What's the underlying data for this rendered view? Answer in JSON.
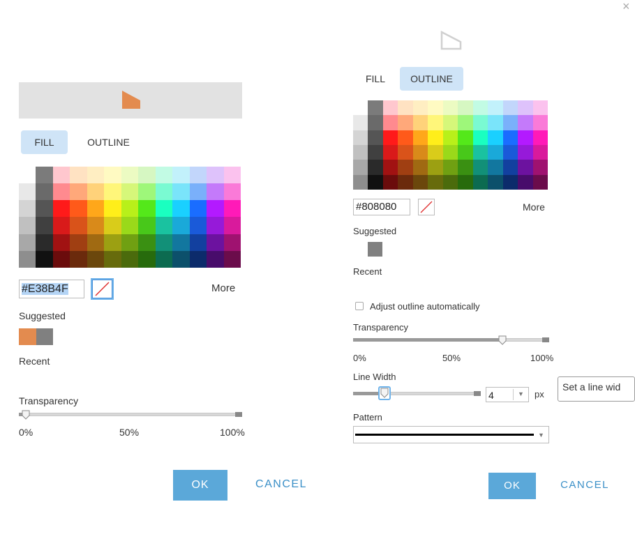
{
  "close_glyph": "×",
  "colors": {
    "accent": "#5ba8d9",
    "tab_active": "#cfe4f7",
    "fill_selected": "#E38B4F",
    "outline_selected": "#808080"
  },
  "palette": {
    "grays": [
      "#ffffff",
      "#e8e8e8",
      "#d4d4d4",
      "#c0c0c0",
      "#a8a8a8",
      "#8e8e8e"
    ],
    "darks": [
      "#7b7b7b",
      "#6a6a6a",
      "#555555",
      "#404040",
      "#2a2a2a",
      "#111111"
    ],
    "hues": [
      [
        "#ffc7ce",
        "#ffe2c2",
        "#ffeec2",
        "#fffac2",
        "#ecfbc2",
        "#d6f7c2",
        "#c2fbe4",
        "#c2f1fb",
        "#c2d6fb",
        "#dec2fb",
        "#fbc2ee"
      ],
      [
        "#ff8a8f",
        "#ffa87a",
        "#ffd27a",
        "#fff67a",
        "#d6f77a",
        "#9ef77a",
        "#7afad2",
        "#7ae4fa",
        "#7ab0fa",
        "#c47afa",
        "#fa7ad8"
      ],
      [
        "#ff1a1a",
        "#ff5a1a",
        "#ffa71a",
        "#ffee1a",
        "#b8f01a",
        "#54e81a",
        "#1affc0",
        "#1ad0ff",
        "#1a6dff",
        "#b31aff",
        "#ff1ab8"
      ],
      [
        "#d91a1a",
        "#d9531a",
        "#d98a1a",
        "#d9cc1a",
        "#9ad91a",
        "#48c81a",
        "#1ac2a0",
        "#1aa9d9",
        "#1a5ad9",
        "#961ad9",
        "#d91a9c"
      ],
      [
        "#a11212",
        "#a03f12",
        "#a06a12",
        "#9ca012",
        "#70a012",
        "#3a9012",
        "#129078",
        "#12779f",
        "#12409f",
        "#6c129f",
        "#9f1270"
      ],
      [
        "#6b0c0c",
        "#6b2a0c",
        "#6b470c",
        "#676b0c",
        "#4b6b0c",
        "#276b0c",
        "#0c6b50",
        "#0c506b",
        "#0c2b6b",
        "#480c6b",
        "#6b0c4b"
      ]
    ]
  },
  "left": {
    "preview_color": "#E38B4F",
    "tabs": {
      "fill": "FILL",
      "outline": "OUTLINE"
    },
    "hex_value": "#E38B4F",
    "more": "More",
    "suggested_label": "Suggested",
    "suggested_colors": [
      "#E38B4F",
      "#808080"
    ],
    "recent_label": "Recent",
    "transparency_label": "Transparency",
    "transparency_value_pct": 3,
    "ticks": [
      "0%",
      "50%",
      "100%"
    ],
    "ok": "OK",
    "cancel": "CANCEL"
  },
  "right": {
    "tabs": {
      "fill": "FILL",
      "outline": "OUTLINE"
    },
    "hex_value": "#808080",
    "more": "More",
    "suggested_label": "Suggested",
    "suggested_colors": [
      "#808080"
    ],
    "recent_label": "Recent",
    "adjust_outline_label": "Adjust outline automatically",
    "transparency_label": "Transparency",
    "transparency_value_pct": 76,
    "ticks": [
      "0%",
      "50%",
      "100%"
    ],
    "line_width_label": "Line Width",
    "line_width_value": "4",
    "line_width_unit": "px",
    "line_width_tooltip": "Set a line wid",
    "pattern_label": "Pattern",
    "ok": "OK",
    "cancel": "CANCEL"
  }
}
